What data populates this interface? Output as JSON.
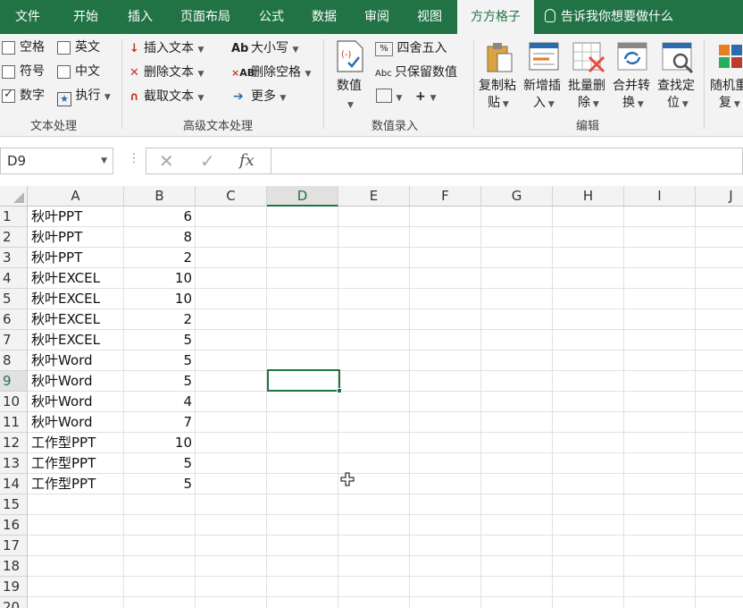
{
  "menu": {
    "tabs": [
      "文件",
      "开始",
      "插入",
      "页面布局",
      "公式",
      "数据",
      "审阅",
      "视图",
      "方方格子"
    ],
    "active_tab": "方方格子",
    "tell_me": "告诉我你想要做什么"
  },
  "ribbon": {
    "text_processing": {
      "checkboxes": [
        {
          "label": "空格",
          "checked": false
        },
        {
          "label": "英文",
          "checked": false
        },
        {
          "label": "符号",
          "checked": false
        },
        {
          "label": "中文",
          "checked": false
        },
        {
          "label": "数字",
          "checked": true
        }
      ],
      "execute_label": "执行",
      "group_label": "文本处理"
    },
    "advanced_text": {
      "insert_text": "插入文本",
      "delete_text": "删除文本",
      "extract_text": "截取文本",
      "case": "大小写",
      "delete_spaces": "删除空格",
      "more": "更多",
      "group_label": "高级文本处理"
    },
    "value_entry": {
      "value_label": "数值",
      "round": "四舍五入",
      "keep_value": "只保留数值",
      "group_label": "数值录入"
    },
    "edit": {
      "copy_paste": [
        "复制粘",
        "贴"
      ],
      "insert_new": [
        "新增插",
        "入"
      ],
      "batch_delete": [
        "批量删",
        "除"
      ],
      "merge_convert": [
        "合并转",
        "换"
      ],
      "find_locate": [
        "查找定",
        "位"
      ],
      "random_repeat": [
        "随机重",
        "复"
      ],
      "group_label": "编辑"
    }
  },
  "formula_bar": {
    "name_box": "D9",
    "formula": ""
  },
  "sheet": {
    "columns": [
      "A",
      "B",
      "C",
      "D",
      "E",
      "F",
      "G",
      "H",
      "I",
      "J"
    ],
    "selected_column": "D",
    "row_numbers": [
      "1",
      "2",
      "3",
      "4",
      "5",
      "6",
      "7",
      "8",
      "9",
      "10",
      "11",
      "12",
      "13",
      "14",
      "15",
      "16",
      "17",
      "18",
      "19",
      "20"
    ],
    "selected_row": "9",
    "rows": [
      {
        "a": "秋叶PPT",
        "b": "6"
      },
      {
        "a": "秋叶PPT",
        "b": "8"
      },
      {
        "a": "秋叶PPT",
        "b": "2"
      },
      {
        "a": "秋叶EXCEL",
        "b": "10"
      },
      {
        "a": "秋叶EXCEL",
        "b": "10"
      },
      {
        "a": "秋叶EXCEL",
        "b": "2"
      },
      {
        "a": "秋叶EXCEL",
        "b": "5"
      },
      {
        "a": "秋叶Word",
        "b": "5"
      },
      {
        "a": "秋叶Word",
        "b": "5"
      },
      {
        "a": "秋叶Word",
        "b": "4"
      },
      {
        "a": "秋叶Word",
        "b": "7"
      },
      {
        "a": "工作型PPT",
        "b": "10"
      },
      {
        "a": "工作型PPT",
        "b": "5"
      },
      {
        "a": "工作型PPT",
        "b": "5"
      }
    ]
  },
  "colors": {
    "accent": "#217346",
    "ribbon_bg": "#f3f3f3",
    "gridline": "#e1e1e1"
  }
}
